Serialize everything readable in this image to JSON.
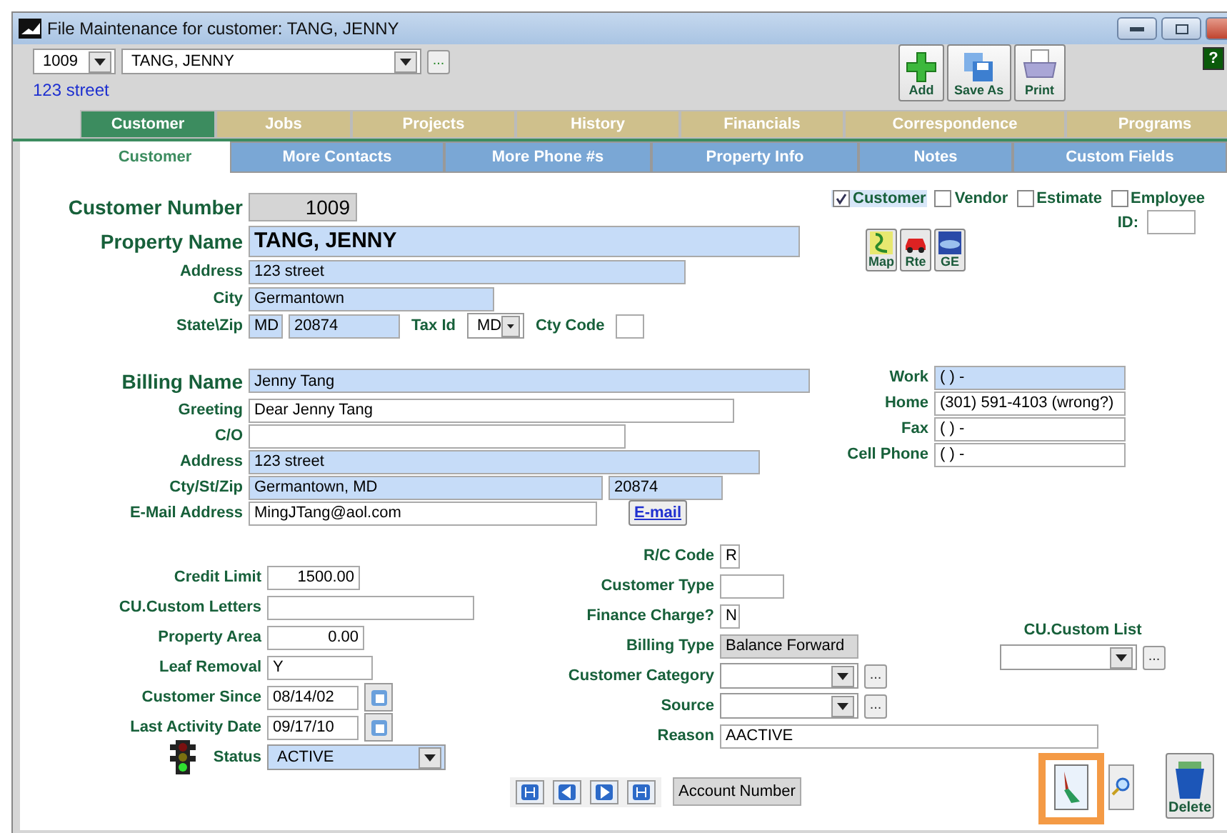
{
  "window": {
    "title": "File Maintenance for customer: TANG, JENNY",
    "help": "?"
  },
  "header": {
    "number": "1009",
    "name": "TANG, JENNY",
    "lookup": "...",
    "address": "123 street"
  },
  "toolbar": [
    {
      "label": "Add",
      "kind": "add"
    },
    {
      "label": "Save As",
      "kind": "save"
    },
    {
      "label": "Print",
      "kind": "print"
    }
  ],
  "tabs": [
    {
      "label": "Customer",
      "selected": true
    },
    {
      "label": "Jobs",
      "selected": false
    },
    {
      "label": "Projects",
      "selected": false
    },
    {
      "label": "History",
      "selected": false
    },
    {
      "label": "Financials",
      "selected": false
    },
    {
      "label": "Correspondence",
      "selected": false
    },
    {
      "label": "Programs",
      "selected": false
    }
  ],
  "subtabs": [
    {
      "label": "Customer",
      "selected": true
    },
    {
      "label": "More Contacts",
      "selected": false
    },
    {
      "label": "More Phone #s",
      "selected": false
    },
    {
      "label": "Property Info",
      "selected": false
    },
    {
      "label": "Notes",
      "selected": false
    },
    {
      "label": "Custom Fields",
      "selected": false
    }
  ],
  "property": [
    {
      "label": "Customer Number",
      "items": [
        {
          "kind": "grey-number",
          "value": "1009"
        }
      ]
    },
    {
      "label": "Property Name",
      "items": [
        {
          "kind": "blue-bold",
          "value": "TANG, JENNY"
        }
      ]
    },
    {
      "label": "Address",
      "items": [
        {
          "kind": "blue",
          "value": "123 street"
        }
      ]
    },
    {
      "label": "City",
      "items": [
        {
          "kind": "blue",
          "value": "Germantown"
        }
      ]
    },
    {
      "label": "State\\Zip",
      "items": [
        {
          "kind": "blue",
          "value": "MD"
        },
        {
          "kind": "blue",
          "value": "20874"
        },
        {
          "kind": "label",
          "value": "Tax Id"
        },
        {
          "kind": "dropdown",
          "value": "MD"
        },
        {
          "kind": "label",
          "value": "Cty Code"
        },
        {
          "kind": "white"
        }
      ]
    }
  ],
  "roles": [
    {
      "label": "Customer",
      "checked": true
    },
    {
      "label": "Vendor",
      "checked": false
    },
    {
      "label": "Estimate",
      "checked": false
    },
    {
      "label": "Employee",
      "checked": false
    }
  ],
  "id_label": "ID:",
  "map_buttons": [
    {
      "label": "Map",
      "kind": "map"
    },
    {
      "label": "Rte",
      "kind": "route"
    },
    {
      "label": "GE",
      "kind": "earth"
    }
  ],
  "billing": [
    {
      "label": "Billing Name",
      "items": [
        {
          "kind": "blue",
          "value": "Jenny Tang"
        }
      ]
    },
    {
      "label": "Greeting",
      "items": [
        {
          "kind": "white",
          "value": "Dear Jenny Tang"
        }
      ]
    },
    {
      "label": "C/O",
      "items": [
        {
          "kind": "white"
        }
      ]
    },
    {
      "label": "Address",
      "items": [
        {
          "kind": "blue",
          "value": "123 street"
        }
      ]
    },
    {
      "label": "Cty/St/Zip",
      "items": [
        {
          "kind": "blue",
          "value": "Germantown, MD"
        },
        {
          "kind": "blue",
          "value": "20874"
        }
      ]
    },
    {
      "label": "E-Mail Address",
      "items": [
        {
          "kind": "white",
          "value": "MingJTang@aol.com"
        },
        {
          "kind": "button",
          "value": "E-mail"
        }
      ]
    }
  ],
  "phones": [
    {
      "label": "Work",
      "value": "( )   -",
      "kind": "blue"
    },
    {
      "label": "Home",
      "value": "(301) 591-4103 (wrong?)",
      "kind": "white"
    },
    {
      "label": "Fax",
      "value": "( )   -",
      "kind": "white"
    },
    {
      "label": "Cell Phone",
      "value": "( )   -",
      "kind": "white"
    }
  ],
  "account": [
    {
      "label": "Credit Limit",
      "items": [
        {
          "kind": "number",
          "value": "1500.00"
        }
      ]
    },
    {
      "label": "CU.Custom Letters",
      "items": [
        {
          "kind": "white"
        }
      ]
    },
    {
      "label": "Property Area",
      "items": [
        {
          "kind": "number",
          "value": "0.00"
        }
      ]
    },
    {
      "label": "Leaf Removal",
      "items": [
        {
          "kind": "white",
          "value": "Y"
        }
      ]
    },
    {
      "label": "Customer Since",
      "items": [
        {
          "kind": "date",
          "value": "08/14/02"
        }
      ]
    },
    {
      "label": "Last Activity Date",
      "items": [
        {
          "kind": "date",
          "value": "09/17/10"
        }
      ]
    },
    {
      "label": "Status",
      "items": [
        {
          "kind": "dropdown-blue",
          "value": "ACTIVE"
        }
      ]
    }
  ],
  "classification": [
    {
      "label": "R/C Code",
      "items": [
        {
          "kind": "white",
          "value": "R"
        }
      ]
    },
    {
      "label": "Customer Type",
      "items": [
        {
          "kind": "white"
        }
      ]
    },
    {
      "label": "Finance Charge?",
      "items": [
        {
          "kind": "white",
          "value": "N"
        }
      ]
    },
    {
      "label": "Billing Type",
      "items": [
        {
          "kind": "grey",
          "value": "Balance Forward"
        }
      ]
    },
    {
      "label": "Customer Category",
      "items": [
        {
          "kind": "dropdown"
        },
        {
          "kind": "ellipsis",
          "value": "..."
        }
      ]
    },
    {
      "label": "Source",
      "items": [
        {
          "kind": "dropdown"
        },
        {
          "kind": "ellipsis",
          "value": "..."
        }
      ]
    },
    {
      "label": "Reason",
      "items": [
        {
          "kind": "white",
          "value": "AACTIVE"
        }
      ]
    }
  ],
  "custom_list": {
    "label": "CU.Custom List",
    "ellipsis": "..."
  },
  "account_number_button": "Account Number",
  "delete_button": "Delete"
}
